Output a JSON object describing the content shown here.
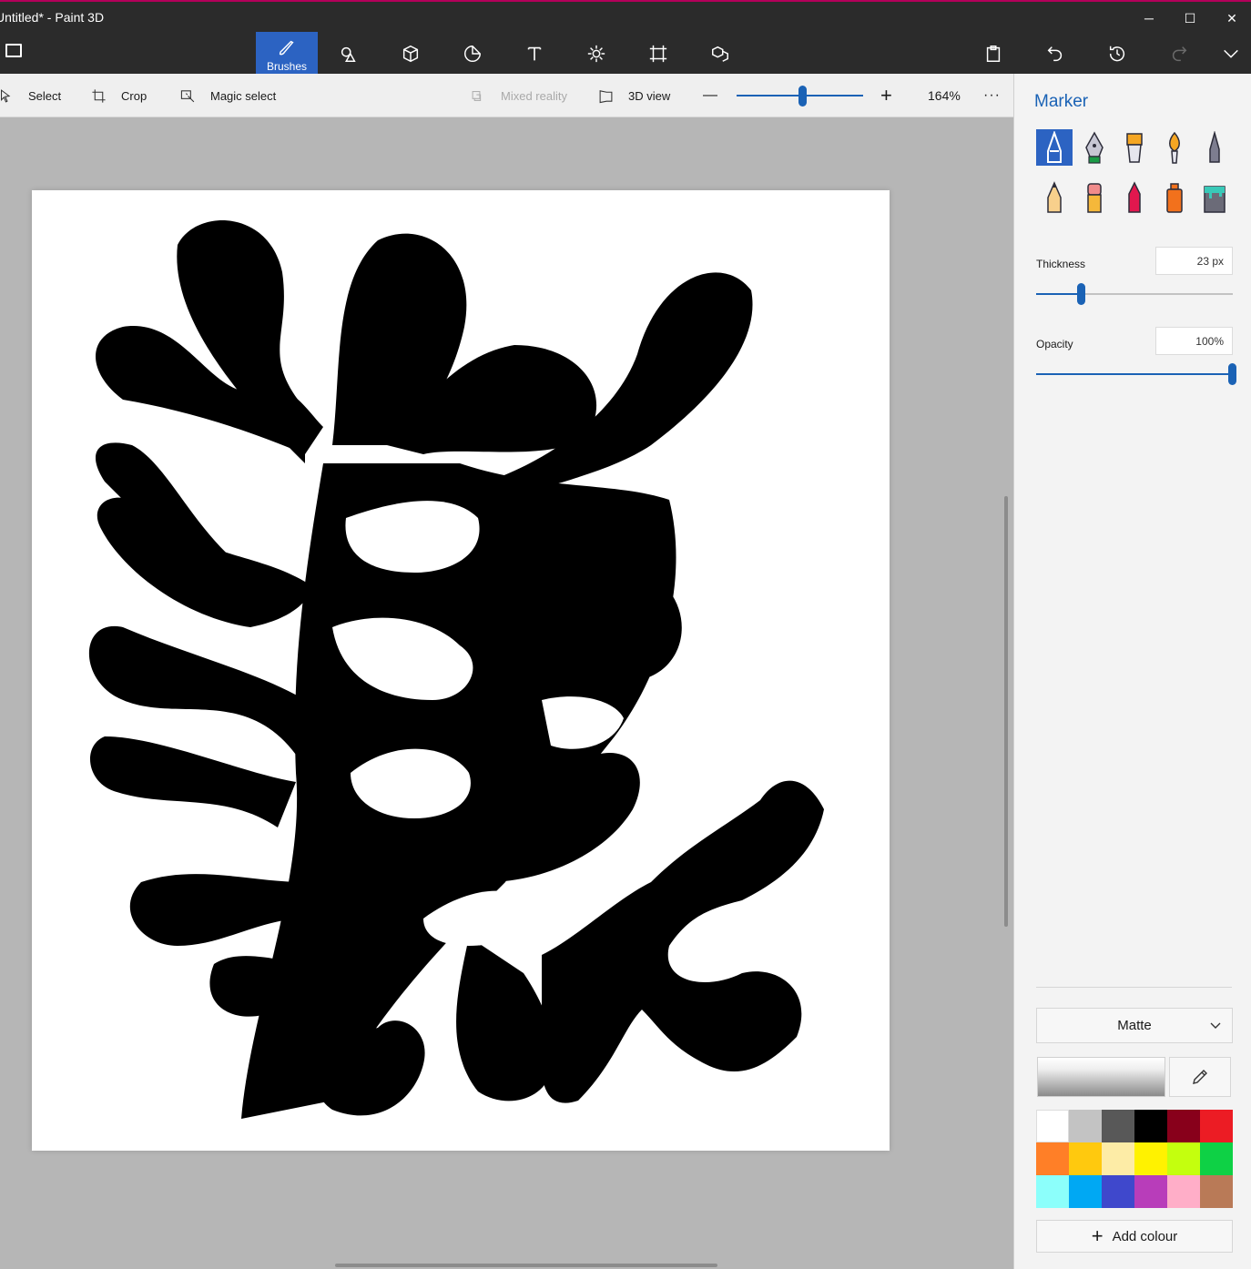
{
  "app": {
    "title": "Untitled* - Paint 3D"
  },
  "window_controls": {
    "minimize": "─",
    "maximize": "☐",
    "close": "✕"
  },
  "ribbon": {
    "active_tool_label": "Brushes",
    "tools": [
      "brushes-icon",
      "2d-shapes-icon",
      "3d-shapes-icon",
      "stickers-icon",
      "text-icon",
      "effects-icon",
      "canvas-icon",
      "3d-library-icon"
    ],
    "right_tools": [
      "paste-icon",
      "undo-icon",
      "history-icon",
      "redo-icon",
      "expand-icon"
    ]
  },
  "commandbar": {
    "select": "Select",
    "crop": "Crop",
    "magic_select": "Magic select",
    "mixed_reality": "Mixed reality",
    "view_3d": "3D view",
    "zoom_minus": "—",
    "zoom_plus": "+",
    "zoom_value": "164%",
    "more": "···",
    "zoom_level_fraction": 0.5
  },
  "panel": {
    "title": "Marker",
    "brushes": [
      {
        "name": "marker-icon",
        "selected": true
      },
      {
        "name": "calligraphy-pen-icon"
      },
      {
        "name": "oil-brush-icon"
      },
      {
        "name": "watercolor-icon"
      },
      {
        "name": "pixel-pen-icon"
      },
      {
        "name": "pencil-icon"
      },
      {
        "name": "eraser-icon"
      },
      {
        "name": "crayon-icon"
      },
      {
        "name": "spray-can-icon"
      },
      {
        "name": "fill-icon"
      }
    ],
    "thickness_label": "Thickness",
    "thickness_value": "23 px",
    "thickness_fraction": 0.23,
    "opacity_label": "Opacity",
    "opacity_value": "100%",
    "opacity_fraction": 1.0,
    "finish": "Matte",
    "add_colour": "Add colour",
    "accent_color": "#1a62b5",
    "palette": [
      "#ffffff",
      "#c3c3c3",
      "#585858",
      "#000000",
      "#88001b",
      "#ec1c24",
      "#ff7f27",
      "#ffc90e",
      "#fdeca6",
      "#fff200",
      "#c4ff0e",
      "#0ed145",
      "#8cfffb",
      "#00a8f3",
      "#3f48cc",
      "#b83dba",
      "#ffaec8",
      "#b97a57"
    ]
  }
}
